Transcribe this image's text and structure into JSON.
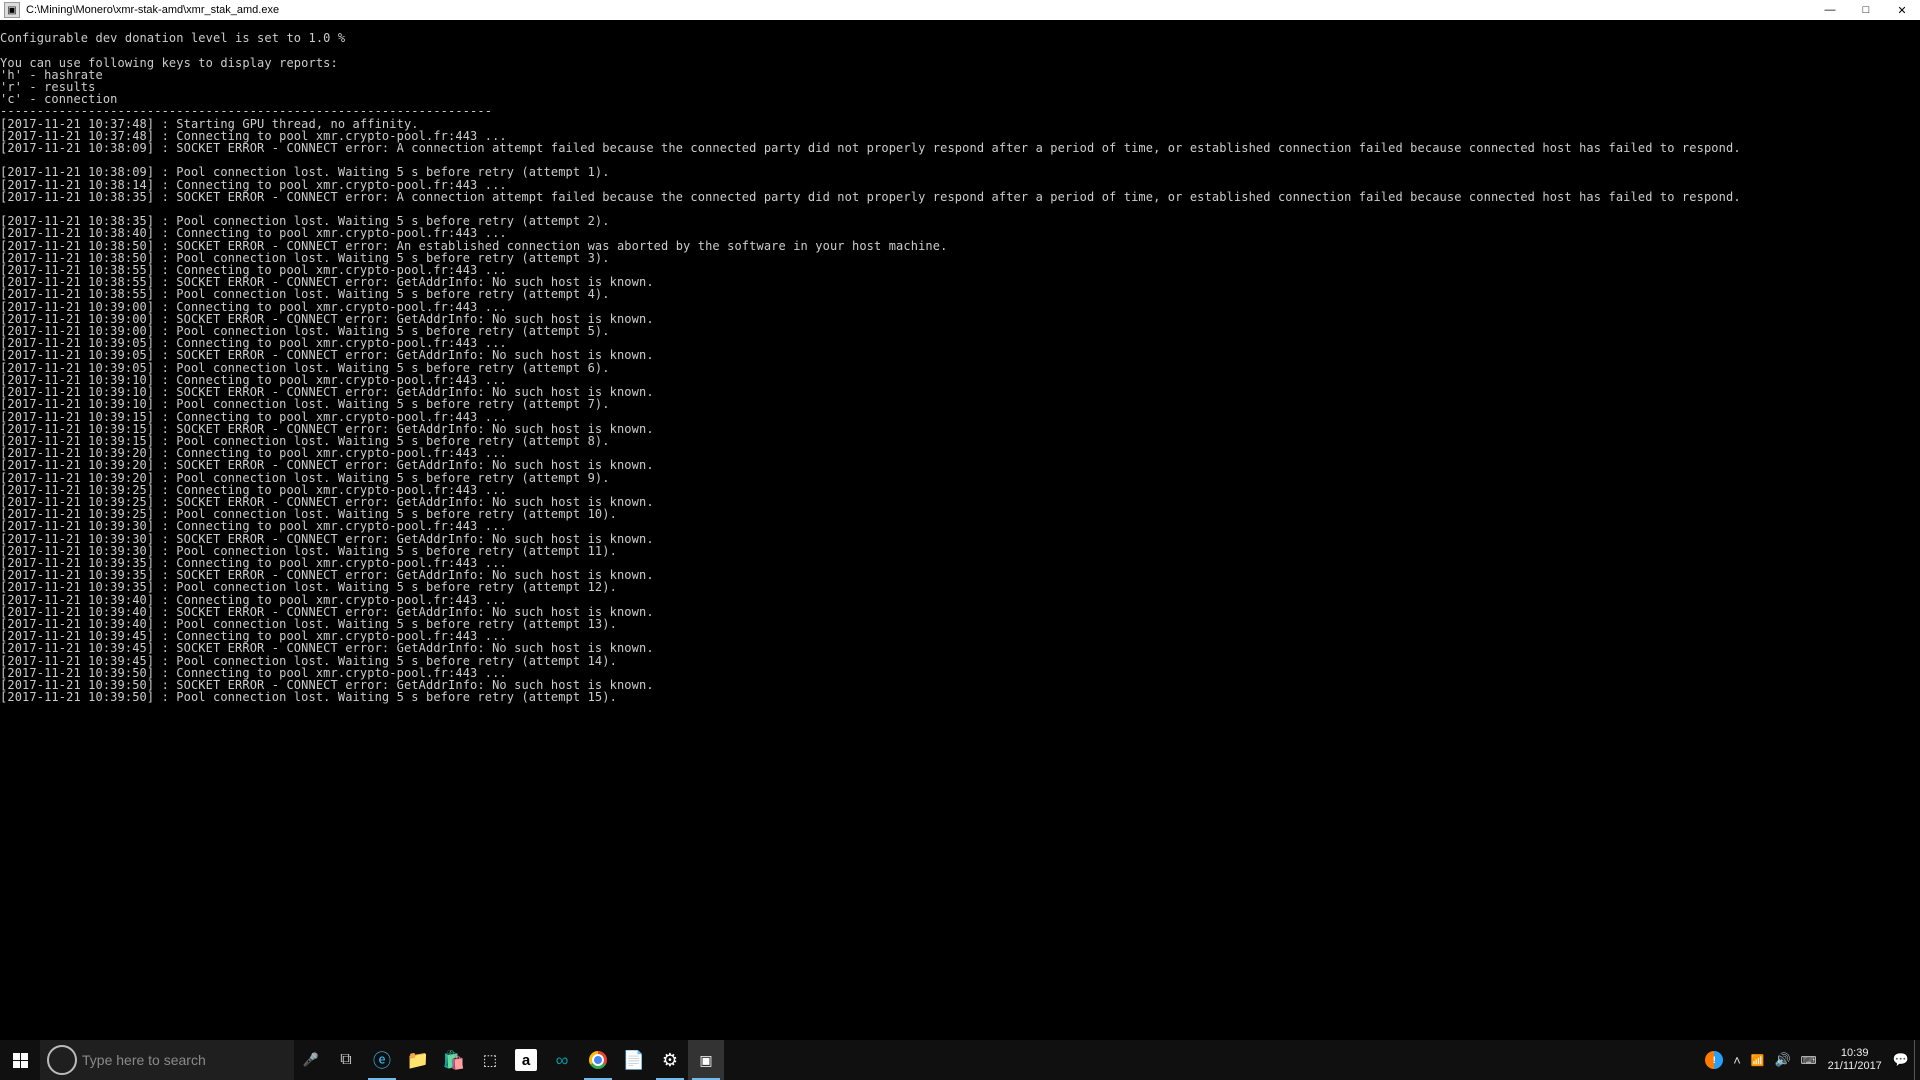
{
  "window": {
    "title": "C:\\Mining\\Monero\\xmr-stak-amd\\xmr_stak_amd.exe",
    "min_tooltip": "Minimize",
    "max_tooltip": "Maximize",
    "close_tooltip": "Close"
  },
  "console": {
    "header": [
      "",
      "Configurable dev donation level is set to 1.0 %",
      "",
      "You can use following keys to display reports:",
      "'h' - hashrate",
      "'r' - results",
      "'c' - connection",
      "-------------------------------------------------------------------"
    ],
    "log": [
      {
        "ts": "2017-11-21 10:37:48",
        "msg": "Starting GPU thread, no affinity."
      },
      {
        "ts": "2017-11-21 10:37:48",
        "msg": "Connecting to pool xmr.crypto-pool.fr:443 ..."
      },
      {
        "ts": "2017-11-21 10:38:09",
        "msg": "SOCKET ERROR - CONNECT error: A connection attempt failed because the connected party did not properly respond after a period of time, or established connection failed because connected host has failed to respond."
      },
      {
        "ts": "",
        "msg": ""
      },
      {
        "ts": "2017-11-21 10:38:09",
        "msg": "Pool connection lost. Waiting 5 s before retry (attempt 1)."
      },
      {
        "ts": "2017-11-21 10:38:14",
        "msg": "Connecting to pool xmr.crypto-pool.fr:443 ..."
      },
      {
        "ts": "2017-11-21 10:38:35",
        "msg": "SOCKET ERROR - CONNECT error: A connection attempt failed because the connected party did not properly respond after a period of time, or established connection failed because connected host has failed to respond."
      },
      {
        "ts": "",
        "msg": ""
      },
      {
        "ts": "2017-11-21 10:38:35",
        "msg": "Pool connection lost. Waiting 5 s before retry (attempt 2)."
      },
      {
        "ts": "2017-11-21 10:38:40",
        "msg": "Connecting to pool xmr.crypto-pool.fr:443 ..."
      },
      {
        "ts": "2017-11-21 10:38:50",
        "msg": "SOCKET ERROR - CONNECT error: An established connection was aborted by the software in your host machine."
      },
      {
        "ts": "2017-11-21 10:38:50",
        "msg": "Pool connection lost. Waiting 5 s before retry (attempt 3)."
      },
      {
        "ts": "2017-11-21 10:38:55",
        "msg": "Connecting to pool xmr.crypto-pool.fr:443 ..."
      },
      {
        "ts": "2017-11-21 10:38:55",
        "msg": "SOCKET ERROR - CONNECT error: GetAddrInfo: No such host is known."
      },
      {
        "ts": "2017-11-21 10:38:55",
        "msg": "Pool connection lost. Waiting 5 s before retry (attempt 4)."
      },
      {
        "ts": "2017-11-21 10:39:00",
        "msg": "Connecting to pool xmr.crypto-pool.fr:443 ..."
      },
      {
        "ts": "2017-11-21 10:39:00",
        "msg": "SOCKET ERROR - CONNECT error: GetAddrInfo: No such host is known."
      },
      {
        "ts": "2017-11-21 10:39:00",
        "msg": "Pool connection lost. Waiting 5 s before retry (attempt 5)."
      },
      {
        "ts": "2017-11-21 10:39:05",
        "msg": "Connecting to pool xmr.crypto-pool.fr:443 ..."
      },
      {
        "ts": "2017-11-21 10:39:05",
        "msg": "SOCKET ERROR - CONNECT error: GetAddrInfo: No such host is known."
      },
      {
        "ts": "2017-11-21 10:39:05",
        "msg": "Pool connection lost. Waiting 5 s before retry (attempt 6)."
      },
      {
        "ts": "2017-11-21 10:39:10",
        "msg": "Connecting to pool xmr.crypto-pool.fr:443 ..."
      },
      {
        "ts": "2017-11-21 10:39:10",
        "msg": "SOCKET ERROR - CONNECT error: GetAddrInfo: No such host is known."
      },
      {
        "ts": "2017-11-21 10:39:10",
        "msg": "Pool connection lost. Waiting 5 s before retry (attempt 7)."
      },
      {
        "ts": "2017-11-21 10:39:15",
        "msg": "Connecting to pool xmr.crypto-pool.fr:443 ..."
      },
      {
        "ts": "2017-11-21 10:39:15",
        "msg": "SOCKET ERROR - CONNECT error: GetAddrInfo: No such host is known."
      },
      {
        "ts": "2017-11-21 10:39:15",
        "msg": "Pool connection lost. Waiting 5 s before retry (attempt 8)."
      },
      {
        "ts": "2017-11-21 10:39:20",
        "msg": "Connecting to pool xmr.crypto-pool.fr:443 ..."
      },
      {
        "ts": "2017-11-21 10:39:20",
        "msg": "SOCKET ERROR - CONNECT error: GetAddrInfo: No such host is known."
      },
      {
        "ts": "2017-11-21 10:39:20",
        "msg": "Pool connection lost. Waiting 5 s before retry (attempt 9)."
      },
      {
        "ts": "2017-11-21 10:39:25",
        "msg": "Connecting to pool xmr.crypto-pool.fr:443 ..."
      },
      {
        "ts": "2017-11-21 10:39:25",
        "msg": "SOCKET ERROR - CONNECT error: GetAddrInfo: No such host is known."
      },
      {
        "ts": "2017-11-21 10:39:25",
        "msg": "Pool connection lost. Waiting 5 s before retry (attempt 10)."
      },
      {
        "ts": "2017-11-21 10:39:30",
        "msg": "Connecting to pool xmr.crypto-pool.fr:443 ..."
      },
      {
        "ts": "2017-11-21 10:39:30",
        "msg": "SOCKET ERROR - CONNECT error: GetAddrInfo: No such host is known."
      },
      {
        "ts": "2017-11-21 10:39:30",
        "msg": "Pool connection lost. Waiting 5 s before retry (attempt 11)."
      },
      {
        "ts": "2017-11-21 10:39:35",
        "msg": "Connecting to pool xmr.crypto-pool.fr:443 ..."
      },
      {
        "ts": "2017-11-21 10:39:35",
        "msg": "SOCKET ERROR - CONNECT error: GetAddrInfo: No such host is known."
      },
      {
        "ts": "2017-11-21 10:39:35",
        "msg": "Pool connection lost. Waiting 5 s before retry (attempt 12)."
      },
      {
        "ts": "2017-11-21 10:39:40",
        "msg": "Connecting to pool xmr.crypto-pool.fr:443 ..."
      },
      {
        "ts": "2017-11-21 10:39:40",
        "msg": "SOCKET ERROR - CONNECT error: GetAddrInfo: No such host is known."
      },
      {
        "ts": "2017-11-21 10:39:40",
        "msg": "Pool connection lost. Waiting 5 s before retry (attempt 13)."
      },
      {
        "ts": "2017-11-21 10:39:45",
        "msg": "Connecting to pool xmr.crypto-pool.fr:443 ..."
      },
      {
        "ts": "2017-11-21 10:39:45",
        "msg": "SOCKET ERROR - CONNECT error: GetAddrInfo: No such host is known."
      },
      {
        "ts": "2017-11-21 10:39:45",
        "msg": "Pool connection lost. Waiting 5 s before retry (attempt 14)."
      },
      {
        "ts": "2017-11-21 10:39:50",
        "msg": "Connecting to pool xmr.crypto-pool.fr:443 ..."
      },
      {
        "ts": "2017-11-21 10:39:50",
        "msg": "SOCKET ERROR - CONNECT error: GetAddrInfo: No such host is known."
      },
      {
        "ts": "2017-11-21 10:39:50",
        "msg": "Pool connection lost. Waiting 5 s before retry (attempt 15)."
      }
    ]
  },
  "taskbar": {
    "search_placeholder": "Type here to search",
    "clock_time": "10:39",
    "clock_date": "21/11/2017"
  }
}
